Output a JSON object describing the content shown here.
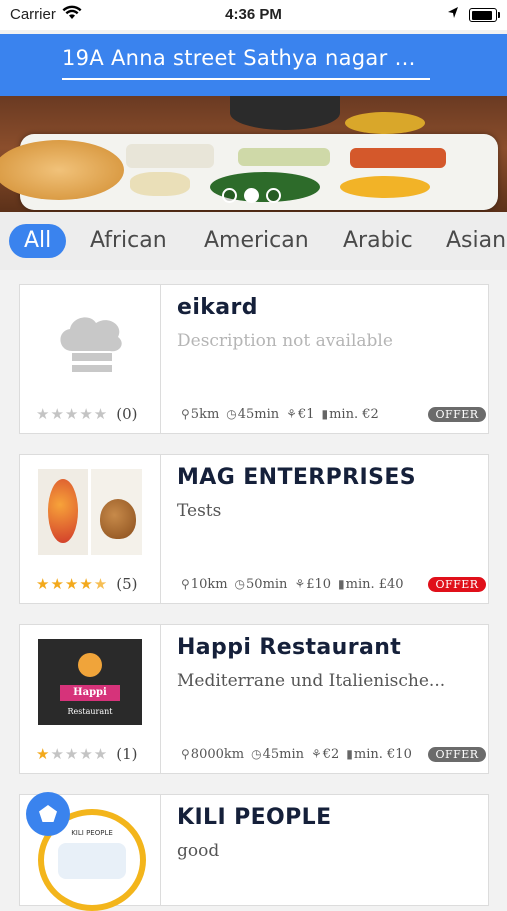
{
  "status_bar": {
    "carrier": "Carrier",
    "time": "4:36 PM"
  },
  "header": {
    "address": "19A Anna street Sathya nagar Anak..."
  },
  "banner": {
    "slides": 3,
    "active_slide": 2
  },
  "categories": [
    "All",
    "African",
    "American",
    "Arabic",
    "Asian"
  ],
  "restaurants": [
    {
      "name": "eikard",
      "description": "Description not available",
      "rating": 0,
      "rating_count": "(0)",
      "distance": "5km",
      "time": "45min",
      "delivery_fee": "€1",
      "min_order": "min. €2",
      "offer": "OFFER",
      "offer_color": "#6b6b6b"
    },
    {
      "name": "MAG ENTERPRISES",
      "description": "Tests",
      "rating": 4.5,
      "rating_count": "(5)",
      "distance": "10km",
      "time": "50min",
      "delivery_fee": "£10",
      "min_order": "min. £40",
      "offer": "OFFER",
      "offer_color": "#e0101a"
    },
    {
      "name": "Happi Restaurant",
      "description": "Mediterrane und Italienische...",
      "rating": 1,
      "rating_count": "(1)",
      "distance": "8000km",
      "time": "45min",
      "delivery_fee": "€2",
      "min_order": "min. €10",
      "offer": "OFFER",
      "offer_color": "#6b6b6b",
      "logo_text": "Happi",
      "logo_subtext": "Restaurant"
    },
    {
      "name": "KILI PEOPLE",
      "description": "good",
      "logo_text": "KILI PEOPLE"
    }
  ],
  "colors": {
    "primary": "#3a83ee",
    "star": "#f3a91c",
    "offer_red": "#e0101a",
    "offer_gray": "#6b6b6b"
  }
}
